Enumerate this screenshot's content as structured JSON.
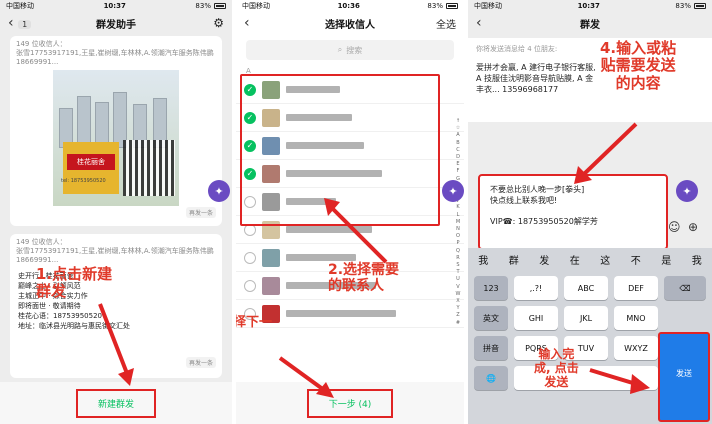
{
  "colors": {
    "wechat_green": "#07c160",
    "annotation_red": "#e02424",
    "fab_purple": "#6a4bc2"
  },
  "panel1": {
    "status": {
      "carrier": "中国移动",
      "time": "10:37",
      "battery": "83%"
    },
    "nav": {
      "back_badge": "1",
      "title": "群发助手",
      "settings_icon": "gear-icon"
    },
    "card1": {
      "recipients": "149 位收信人：",
      "names": "张雪17753917191,王星,崔树缀,车林林,A.领潮汽车服务陈伟鹏18669991...",
      "poster_text": "桂花丽舍",
      "poster_tel": "tel: 18753950520",
      "resend": "再发一条"
    },
    "card2": {
      "recipients": "149 位收信人：",
      "names": "张雪17753917191,王星,崔树缀,车林林,A.领潮汽车服务陈伟鹏18669991...",
      "lines": [
        "史开行 · 桂花丽舍",
        "巅峰之上 · 引领风范",
        "主城正中 · 综合实力作",
        "即将面世 · 敬请期待",
        "桂花心语：18753950520",
        "地址：临沭县光明路与惠民街交汇处"
      ],
      "resend": "再发一条"
    },
    "footer_button": "新建群发",
    "annotation": "1.点击新建\n群发"
  },
  "panel2": {
    "status": {
      "carrier": "中国移动",
      "time": "10:36",
      "battery": "83%"
    },
    "nav": {
      "title": "选择收信人",
      "right": "全选"
    },
    "search_placeholder": "搜索",
    "section_letter": "A",
    "contacts": [
      {
        "checked": true
      },
      {
        "checked": true
      },
      {
        "checked": true
      },
      {
        "checked": true
      },
      {
        "checked": false
      },
      {
        "checked": false
      },
      {
        "checked": false
      },
      {
        "checked": false
      },
      {
        "checked": false
      }
    ],
    "alphabet": [
      "↑",
      "☆",
      "A",
      "B",
      "C",
      "D",
      "E",
      "F",
      "G",
      "H",
      "I",
      "J",
      "K",
      "L",
      "M",
      "N",
      "O",
      "P",
      "Q",
      "R",
      "S",
      "T",
      "U",
      "V",
      "W",
      "X",
      "Y",
      "Z",
      "#"
    ],
    "footer_button": "下一步 (4)",
    "annotation2": "2.选择需要\n的联系人",
    "annotation3": "3.选择下一\n步"
  },
  "panel3": {
    "status": {
      "carrier": "中国移动",
      "time": "10:37",
      "battery": "83%"
    },
    "nav": {
      "title": "群发"
    },
    "info": "你将发送消息给 4 位朋友:",
    "recipients": "爱拼才会赢, A 建行电子银行客服, A 技服佳沈明影音导航贴膜, A 金丰衣... 13596968177",
    "message_line1": "不要总比别人晚一步[拳头]",
    "message_line2": "快点线上联系我吧!",
    "message_line3": "VIP☎: 18753950520解学芳",
    "candidates": [
      "我",
      "群",
      "发",
      "在",
      "这",
      "不",
      "是",
      "我"
    ],
    "keys_row1": [
      "123",
      ",.?!",
      "ABC",
      "DEF",
      "⌫"
    ],
    "keys_row2": [
      "英文",
      "GHI",
      "JKL",
      "MNO"
    ],
    "keys_row3": [
      "拼音",
      "PQRS",
      "TUV",
      "WXYZ"
    ],
    "send_label": "发送",
    "annotation4": "4.输入或粘\n贴需要发送\n的内容",
    "annotation5": "输入完\n成, 点击\n发送"
  }
}
